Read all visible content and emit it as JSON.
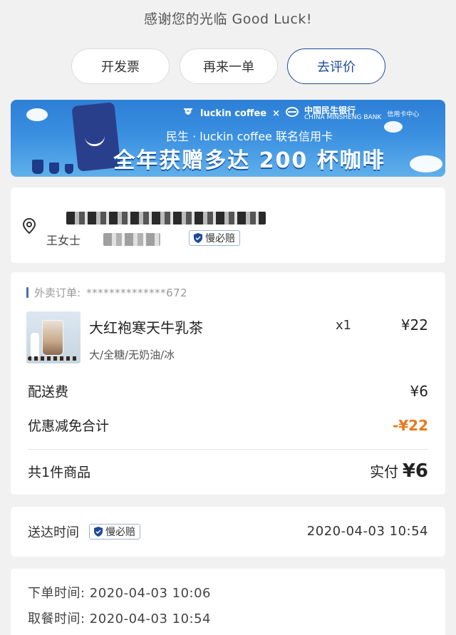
{
  "header": {
    "thanks": "感谢您的光临 Good Luck!"
  },
  "actions": {
    "invoice": "开发票",
    "reorder": "再来一单",
    "review": "去评价"
  },
  "banner": {
    "brand_luckin": "luckin coffee",
    "brand_x": "×",
    "brand_bank": "中国民生银行",
    "brand_bank_en": "CHINA MINSHENG BANK",
    "brand_bank_sub": "信用卡中心",
    "line2": "民生 · luckin coffee 联名信用卡",
    "line3": "全年获赠多达 200 杯咖啡"
  },
  "address": {
    "name": "王女士",
    "badge": "慢必赔"
  },
  "order": {
    "order_no_label": "外卖订单:",
    "order_no": "**************672",
    "product": {
      "name": "大红袍寒天牛乳茶",
      "spec": "大/全糖/无奶油/冰",
      "qty": "x1",
      "price": "¥22"
    },
    "delivery_fee_label": "配送费",
    "delivery_fee": "¥6",
    "discount_label": "优惠减免合计",
    "discount": "-¥22",
    "total_items": "共1件商品",
    "paid_label": "实付",
    "paid_amount": "¥6"
  },
  "delivery": {
    "label": "送达时间",
    "badge": "慢必赔",
    "time": "2020-04-03 10:54"
  },
  "times": {
    "order_time": "下单时间: 2020-04-03 10:06",
    "pickup_time": "取餐时间: 2020-04-03 10:54"
  }
}
